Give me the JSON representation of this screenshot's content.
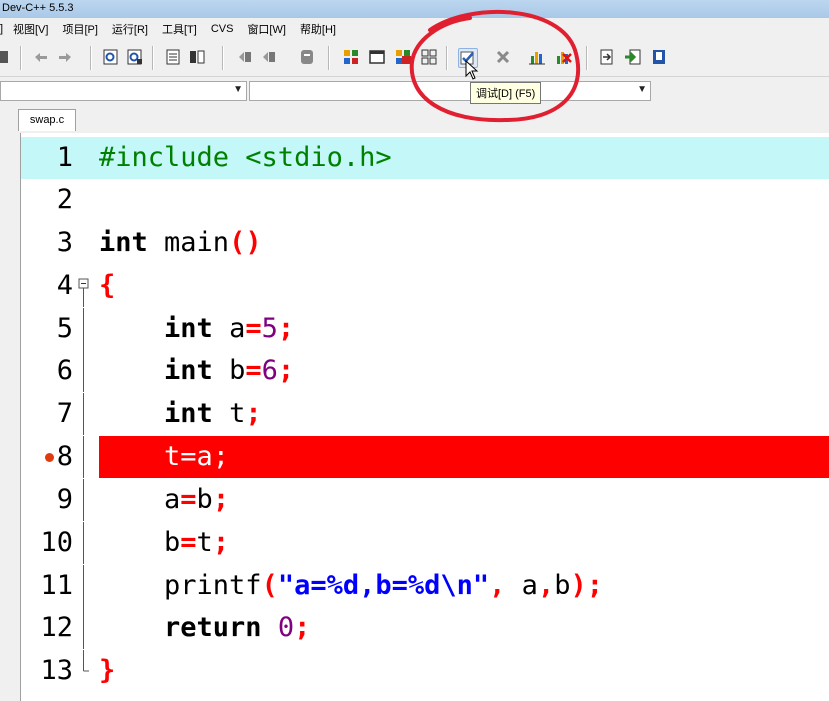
{
  "window": {
    "title": "Dev-C++ 5.5.3"
  },
  "menu": {
    "items": [
      "视图[V]",
      "项目[P]",
      "运行[R]",
      "工具[T]",
      "CVS",
      "窗口[W]",
      "帮助[H]"
    ],
    "left_edge": "]"
  },
  "toolbar": {
    "buttons": [
      "compile",
      "run",
      "compile-run",
      "rebuild",
      "debug",
      "stop",
      "profile",
      "delete-profile",
      "goto",
      "add-watch",
      "view-cpu"
    ],
    "tooltip": "调试[D] (F5)"
  },
  "editor": {
    "tab_label": "swap.c",
    "lines": [
      {
        "no": "1",
        "text": "#include <stdio.h>"
      },
      {
        "no": "2",
        "text": ""
      },
      {
        "no": "3",
        "text": "int main()"
      },
      {
        "no": "4",
        "text": "{"
      },
      {
        "no": "5",
        "text": "    int a=5;"
      },
      {
        "no": "6",
        "text": "    int b=6;"
      },
      {
        "no": "7",
        "text": "    int t;"
      },
      {
        "no": "8",
        "text": "    t=a;"
      },
      {
        "no": "9",
        "text": "    a=b;"
      },
      {
        "no": "10",
        "text": "    b=t;"
      },
      {
        "no": "11",
        "text": "    printf(\"a=%d,b=%d\\n\", a,b);"
      },
      {
        "no": "12",
        "text": "    return 0;"
      },
      {
        "no": "13",
        "text": "}"
      }
    ],
    "current_line": "1",
    "breakpoint_line": "8"
  },
  "colors": {
    "breakpoint": "#ff0000",
    "current_line": "#c4f8f8",
    "keyword": "#000000",
    "preprocessor": "#008000",
    "number": "#800080",
    "string": "#0000ff",
    "symbol": "#ff0000",
    "annotation": "#e02020"
  }
}
